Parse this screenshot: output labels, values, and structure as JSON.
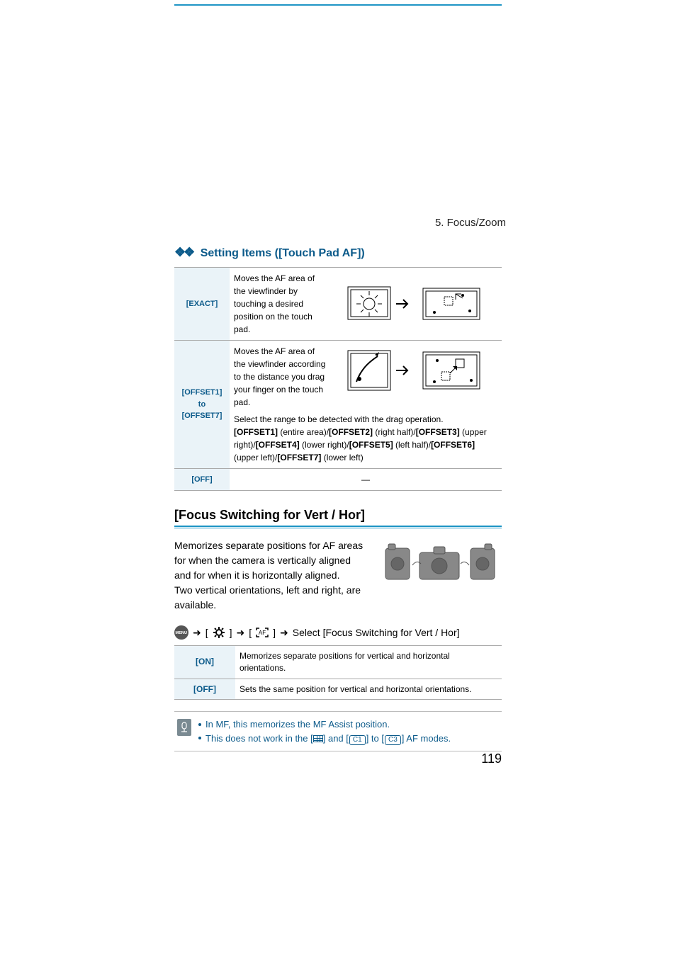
{
  "header": {
    "chapter": "5. Focus/Zoom"
  },
  "section1": {
    "title": "Setting Items ([Touch Pad AF])",
    "rows": {
      "exact": {
        "label": "[EXACT]",
        "desc": "Moves the AF area of the viewfinder by touching a desired position on the touch pad."
      },
      "offset": {
        "label": "[OFFSET1] to [OFFSET7]",
        "desc": "Moves the AF area of the viewfinder according to the distance you drag your finger on the touch pad.",
        "range_intro": "Select the range to be detected with the drag operation.",
        "range_parts": {
          "p1a": "[OFFSET1]",
          "p1b": " (entire area)/",
          "p2a": "[OFFSET2]",
          "p2b": " (right half)/",
          "p3a": "[OFFSET3]",
          "p3b": " (upper right)/",
          "p4a": "[OFFSET4]",
          "p4b": " (lower right)/",
          "p5a": "[OFFSET5]",
          "p5b": " (left half)/",
          "p6a": "[OFFSET6]",
          "p6b": " (upper left)/",
          "p7a": "[OFFSET7]",
          "p7b": " (lower left)"
        }
      },
      "off": {
        "label": "[OFF]",
        "desc": "—"
      }
    }
  },
  "section2": {
    "title": "[Focus Switching for Vert / Hor]",
    "para1": "Memorizes separate positions for AF areas for when the camera is vertically aligned and for when it is horizontally aligned.",
    "para2": "Two vertical orientations, left and right, are available.",
    "menu_path_tail": "Select [Focus Switching for Vert / Hor]",
    "icons": {
      "menu": "MENU",
      "gear": "gear-icon",
      "af": "AF"
    },
    "table": {
      "on": {
        "label": "[ON]",
        "desc": "Memorizes separate positions for vertical and horizontal orientations."
      },
      "off": {
        "label": "[OFF]",
        "desc": "Sets the same position for vertical and horizontal orientations."
      }
    },
    "notes": {
      "n1": "In MF, this memorizes the MF Assist position.",
      "n2a": "This does not work in the [",
      "n2b": "] and [",
      "n2c": "] to [",
      "n2d": "] AF modes.",
      "c1": "C1",
      "c3": "C3"
    }
  },
  "page_number": "119"
}
